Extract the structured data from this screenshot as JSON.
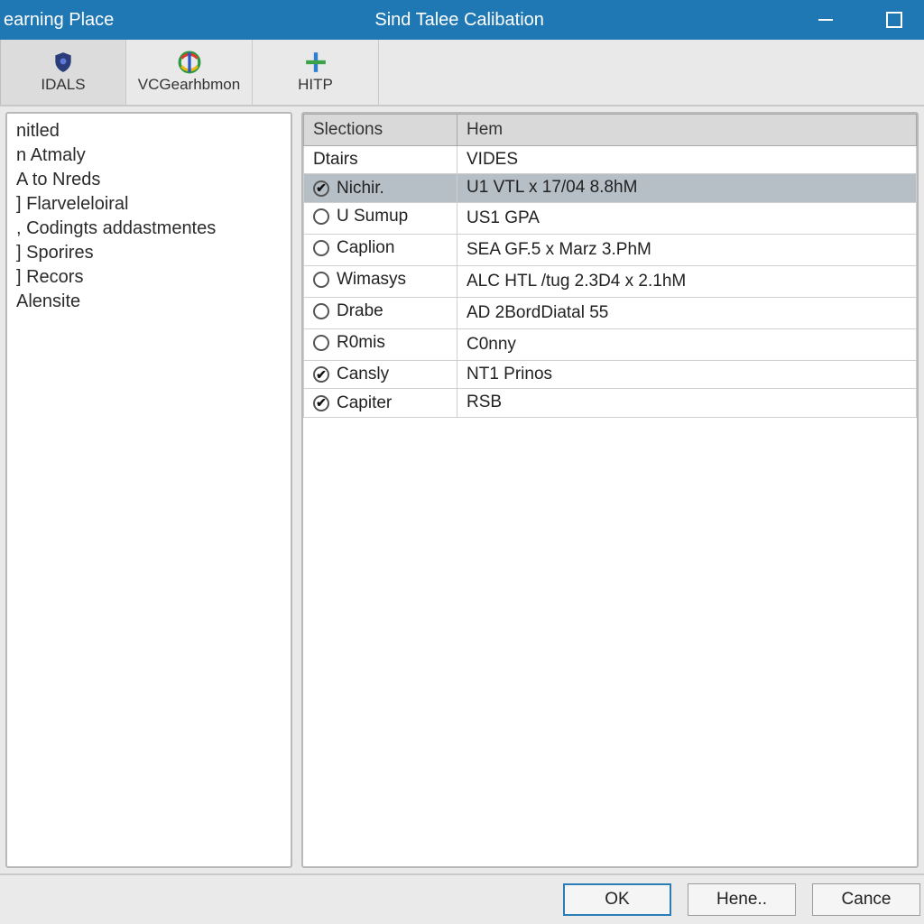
{
  "titlebar": {
    "left": "earning Place",
    "center": "Sind Talee Calibation"
  },
  "tabs": [
    {
      "label": "IDALS"
    },
    {
      "label": "VCGearhbmon"
    },
    {
      "label": "HITP"
    }
  ],
  "sidebar": {
    "items": [
      "nitled",
      "n Atmaly",
      "A to Nreds",
      "] Flarveleloiral",
      ", Codingts addastmentes",
      "] Sporires",
      "] Recors",
      "Alensite"
    ]
  },
  "table": {
    "headers": {
      "col1": "Slections",
      "col2": "Hem"
    },
    "rows": [
      {
        "type": "plain",
        "col1": "Dtairs",
        "col2": "VIDES",
        "selected": false
      },
      {
        "type": "check",
        "checked": true,
        "col1": "Nichir.",
        "col2": "U1 VTL x 17/04 8.8hM",
        "selected": true
      },
      {
        "type": "radio",
        "checked": false,
        "col1": "U Sumup",
        "col2": "US1 GPA",
        "selected": false
      },
      {
        "type": "radio",
        "checked": false,
        "col1": "Caplion",
        "col2": "SEA GF.5 x Marz 3.PhM",
        "selected": false
      },
      {
        "type": "radio",
        "checked": false,
        "col1": "Wimasys",
        "col2": "ALC HTL /tug  2.3D4 x 2.1hM",
        "selected": false
      },
      {
        "type": "radio",
        "checked": false,
        "col1": "Drabe",
        "col2": "AD 2BordDiatal 55",
        "selected": false
      },
      {
        "type": "radio",
        "checked": false,
        "col1": "R0mis",
        "col2": "C0nny",
        "selected": false
      },
      {
        "type": "check",
        "checked": true,
        "col1": "Cansly",
        "col2": "NT1 Prinos",
        "selected": false
      },
      {
        "type": "check",
        "checked": true,
        "col1": "Capiter",
        "col2": "RSB",
        "selected": false
      }
    ]
  },
  "footer": {
    "ok": "OK",
    "help": "Hene..",
    "cancel": "Cance"
  }
}
